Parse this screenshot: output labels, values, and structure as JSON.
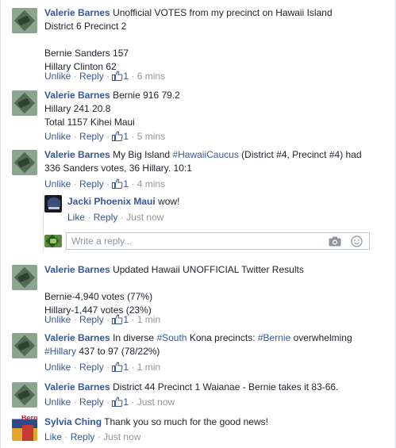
{
  "colors": {
    "link": "#365899",
    "meta": "#90949c",
    "text": "#1d2129"
  },
  "actions": {
    "unlike": "Unlike",
    "like": "Like",
    "reply": "Reply",
    "separator": "·"
  },
  "comments": [
    {
      "author": "Valerie Barnes",
      "lines": [
        "Unofficial VOTES from my precinct on Hawaii Island",
        "District 6 Precinct 2",
        "",
        "Bernie Sanders 157",
        "Hillary Clinton 62"
      ],
      "likes": "1",
      "time": "6 mins"
    },
    {
      "author": "Valerie Barnes",
      "lines": [
        "Bernie 916 79.2",
        "Hillary 241 20.8",
        "Total 1157 Kihei Maui"
      ],
      "likes": "1",
      "time": "5 mins"
    },
    {
      "author": "Valerie Barnes",
      "text_before": "My Big Island ",
      "hashtag": "#HawaiiCaucus",
      "text_after": " (District #4, Precinct #4) had",
      "line2": "336 Sanders votes, 36 Hillary. 10:1",
      "likes": "1",
      "time": "4 mins"
    },
    {
      "author": "Valerie Barnes",
      "lines": [
        "Updated Hawaii UNOFFICIAL Twitter Results",
        "",
        "Bernie-4,940 votes (77%)",
        "Hillary-1,447 votes (23%)"
      ],
      "likes": "1",
      "time": "1 min"
    },
    {
      "author": "Valerie Barnes",
      "p1": "In diverse ",
      "h1": "#South",
      "p2": " Kona precincts: ",
      "h2": "#Bernie",
      "p3": " overwhelming",
      "h3": "#Hillary",
      "p4": " 437 to 97 (78/22%)",
      "likes": "1",
      "time": "1 min"
    },
    {
      "author": "Valerie Barnes",
      "lines": [
        "District 44 Precinct 1 Waianae - Bernie takes it 83-66."
      ],
      "likes": "1",
      "time": "Just now"
    },
    {
      "author": "Sylvia Ching",
      "lines": [
        "Thank you so much for the good news!"
      ],
      "time": "Just now",
      "avatar_tag": "Bernie"
    }
  ],
  "nested_reply": {
    "author": "Jacki Phoenix Maui",
    "text": "wow!",
    "time": "Just now"
  },
  "reply_box": {
    "placeholder": "Write a reply..."
  },
  "icons": {
    "like": "thumbs-up-icon",
    "camera": "camera-icon",
    "emoji": "smiley-icon"
  }
}
